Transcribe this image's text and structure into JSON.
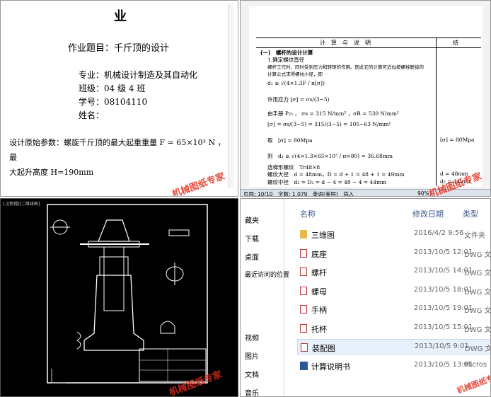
{
  "doc1": {
    "title": "业",
    "topic": "作业题目：千斤顶的设计",
    "fields": [
      "专业：机械设计制造及其自动化",
      "班级：04 级 4 班",
      "学号：08104110",
      "姓名："
    ],
    "params_line1": "设计原始参数：螺旋千斤顶的最大起重重量 F = 65×10³ N ，最",
    "params_line2": "大起升高度 H=190mm"
  },
  "doc2": {
    "header_calc": "计　算　与　说　明",
    "header_result": "结",
    "section_title": "(一)　螺杆的设计计算",
    "lines": [
      "1.确定螺纹直径",
      "螺杆工作时，同时受到压力和转矩的作用。因此它的计算可近似按螺栓联接的",
      "计算公式求得螺纹小径，即",
      "d₁ ≥ √(4×1.3F / π[σ])",
      "许用应力 [σ] = σs/(3~5)",
      "由手册 P₂₅ ， σs = 315 N/mm² ，σB = 530 N/mm²",
      "[σ] = σs/(3~5) = 315/(3~5) = 105~63 N/mm²",
      "取　[σ] = 80Mpa",
      "则　d₁ ≥ √(4×1.3×65×10³ / π×80) = 36.68mm",
      "选梯形螺纹　Tr48×8",
      "螺纹大径　d = 48mm，D = d + 1 = 48 + 1 = 49mm",
      "螺纹中径　d₂ = D₂ = d − 4 = 48 − 4 = 44mm"
    ],
    "results": [
      "[σ] = 80Mpa",
      "d = 48mm",
      "d₂ = 44mm"
    ],
    "status_bar": "页面: 10/10　字数: 1,079　英语(美国)　插入",
    "zoom": "90%"
  },
  "cad": {
    "window_title": "[-][俯视][二维线框]"
  },
  "explorer": {
    "nav": [
      "藏夹",
      "下载",
      "桌面",
      "最近访问的位置",
      "视频",
      "图片",
      "文档",
      "音乐"
    ],
    "columns": {
      "name": "名称",
      "date": "修改日期",
      "type": "类型"
    },
    "files": [
      {
        "name": "三维图",
        "date": "2016/4/2 9:56",
        "type": "文件夹",
        "kind": "folder"
      },
      {
        "name": "底座",
        "date": "2013/10/5 12:01",
        "type": "DWG 文",
        "kind": "dwg"
      },
      {
        "name": "螺杆",
        "date": "2013/10/5 14:01",
        "type": "DWG 文",
        "kind": "dwg"
      },
      {
        "name": "螺母",
        "date": "2013/10/5 18:01",
        "type": "DWG 文",
        "kind": "dwg"
      },
      {
        "name": "手柄",
        "date": "2013/10/5 19:01",
        "type": "DWG 文",
        "kind": "dwg"
      },
      {
        "name": "托杯",
        "date": "2013/10/5 15:01",
        "type": "DWG 文",
        "kind": "dwg"
      },
      {
        "name": "装配图",
        "date": "2013/10/5 9:01",
        "type": "DWG 文",
        "kind": "dwg"
      },
      {
        "name": "计算说明书",
        "date": "2013/10/5 13:01",
        "type": "Micros",
        "kind": "doc"
      }
    ]
  },
  "watermark": "机械图纸专家"
}
